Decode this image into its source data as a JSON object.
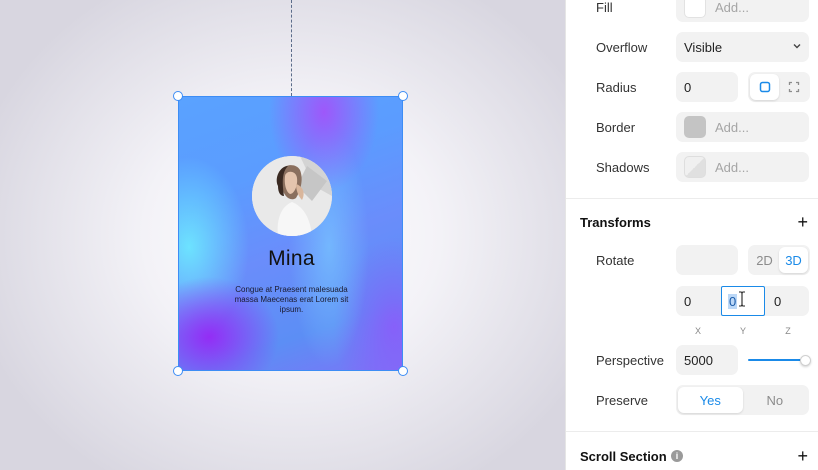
{
  "card": {
    "name": "Mina",
    "bio": "Congue at Praesent malesuada massa Maecenas erat Lorem sit ipsum."
  },
  "inspector": {
    "fill": {
      "label": "Fill",
      "placeholder": "Add..."
    },
    "overflow": {
      "label": "Overflow",
      "value": "Visible"
    },
    "radius": {
      "label": "Radius",
      "value": "0"
    },
    "border": {
      "label": "Border",
      "placeholder": "Add..."
    },
    "shadows": {
      "label": "Shadows",
      "placeholder": "Add..."
    },
    "transforms": {
      "title": "Transforms",
      "add": "+",
      "rotate": {
        "label": "Rotate",
        "value": "",
        "mode_2d": "2D",
        "mode_3d": "3D",
        "active_mode": "3D"
      },
      "xyz": {
        "x": "0",
        "y": "0",
        "z": "0",
        "x_label": "X",
        "y_label": "Y",
        "z_label": "Z"
      },
      "perspective": {
        "label": "Perspective",
        "value": "5000",
        "slider_fraction": 0.95
      },
      "preserve": {
        "label": "Preserve",
        "yes": "Yes",
        "no": "No",
        "active": "Yes"
      }
    },
    "scroll_section": {
      "title": "Scroll Section",
      "info": "i",
      "add": "+"
    }
  },
  "colors": {
    "accent": "#1a8ae8",
    "selection": "#3d8df5",
    "border_swatch": "#c4c4c4"
  }
}
